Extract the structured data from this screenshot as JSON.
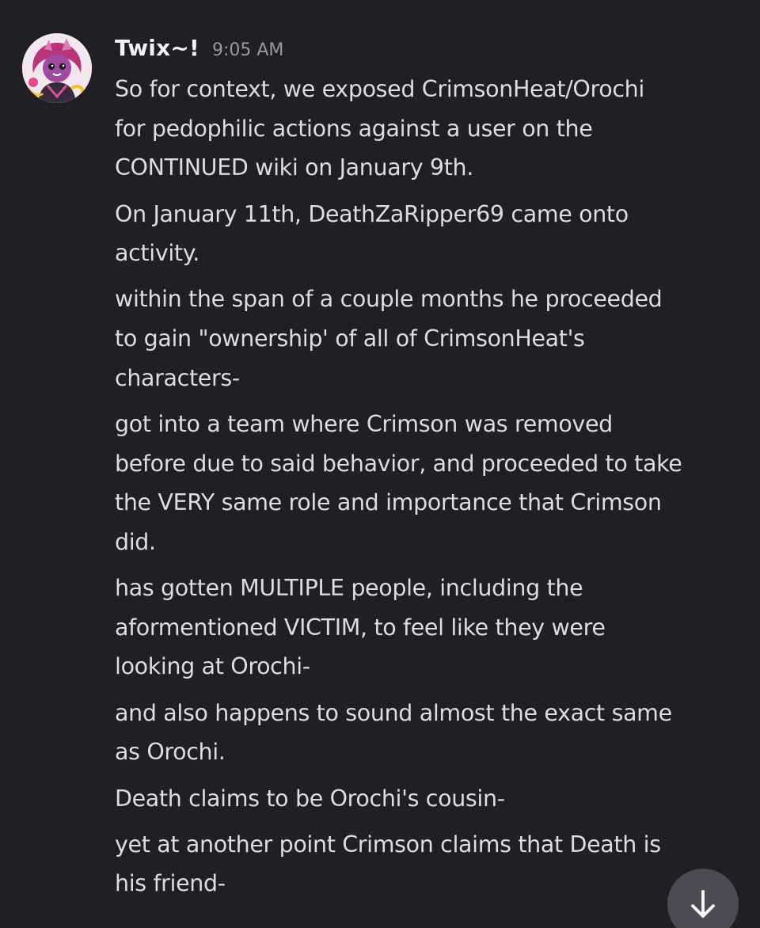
{
  "message": {
    "author": "Twix~!",
    "timestamp": "9:05 AM",
    "avatar_icon": "cartoon-character-avatar-icon",
    "lines": [
      "So for context, we exposed CrimsonHeat/Orochi",
      "for pedophilic actions against a user on the",
      "CONTINUED wiki on January 9th.",
      "On January 11th, DeathZaRipper69 came onto",
      "activity.",
      "within the span of a couple months he proceeded",
      "to gain \"ownership' of all of CrimsonHeat's",
      "characters-",
      "got into a team where Crimson was removed",
      "before due to said behavior, and proceeded to take",
      "the VERY same role and importance that Crimson",
      "did.",
      "has gotten MULTIPLE people, including the",
      "aformentioned VICTIM, to feel like they were",
      "looking at Orochi-",
      "and also happens to sound almost the exact same",
      "as Orochi.",
      "Death claims to be Orochi's cousin-",
      "yet at another point Crimson claims that Death is",
      "his friend-"
    ]
  },
  "scroll_button": {
    "icon": "arrow-down-icon"
  },
  "colors": {
    "background": "#1f1f24",
    "text": "#dbdee1",
    "username": "#f2f3f5",
    "timestamp": "#949ba4",
    "scroll_button": "#4a4b53"
  }
}
